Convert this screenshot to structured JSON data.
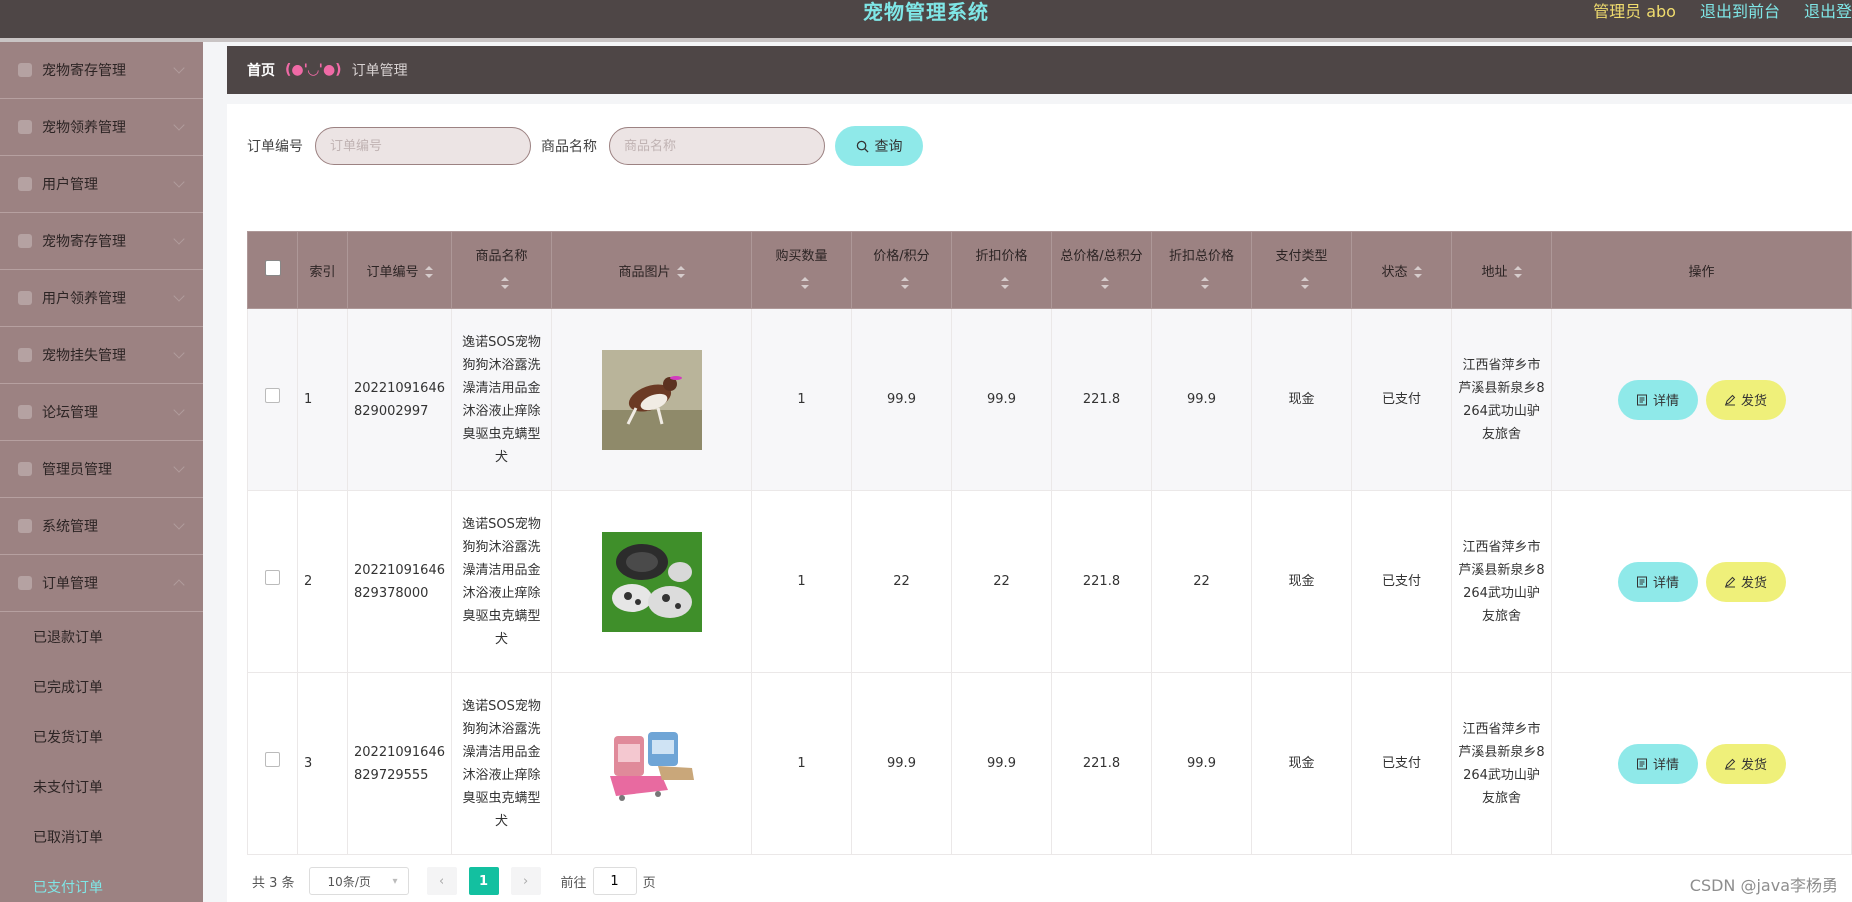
{
  "header": {
    "title": "宠物管理系统",
    "admin": "管理员 abo",
    "to_front": "退出到前台",
    "logout": "退出登"
  },
  "sidebar": {
    "items": [
      {
        "label": "宠物寄存管理",
        "icon": "shield-icon"
      },
      {
        "label": "宠物领养管理",
        "icon": "building-icon"
      },
      {
        "label": "用户管理",
        "icon": "folder-icon"
      },
      {
        "label": "宠物寄存管理",
        "icon": "chart-icon"
      },
      {
        "label": "用户领养管理",
        "icon": "grid-icon"
      },
      {
        "label": "宠物挂失管理",
        "icon": "lock-icon"
      },
      {
        "label": "论坛管理",
        "icon": "clipboard-icon"
      },
      {
        "label": "管理员管理",
        "icon": "send-icon"
      },
      {
        "label": "系统管理",
        "icon": "screen-icon"
      },
      {
        "label": "订单管理",
        "icon": "user-icon"
      }
    ],
    "sub_items": [
      "已退款订单",
      "已完成订单",
      "已发货订单",
      "未支付订单",
      "已取消订单",
      "已支付订单"
    ]
  },
  "breadcrumb": {
    "home": "首页",
    "sep": "(●'◡'●)",
    "current": "订单管理"
  },
  "search": {
    "order_label": "订单编号",
    "order_placeholder": "订单编号",
    "product_label": "商品名称",
    "product_placeholder": "商品名称",
    "query_label": "查询"
  },
  "table": {
    "headers": {
      "index": "索引",
      "order_no": "订单编号",
      "product_name": "商品名称",
      "product_image": "商品图片",
      "quantity": "购买数量",
      "price": "价格/积分",
      "discount_price": "折扣价格",
      "total": "总价格/总积分",
      "discount_total": "折扣总价格",
      "pay_type": "支付类型",
      "status": "状态",
      "address": "地址",
      "ops": "操作"
    },
    "rows": [
      {
        "index": "1",
        "order_no": "20221091646829002997",
        "product_name": "逸诺SOS宠物狗狗沐浴露洗澡清洁用品金沐浴液止痒除臭驱虫克螨型犬",
        "quantity": "1",
        "price": "99.9",
        "discount_price": "99.9",
        "total": "221.8",
        "discount_total": "99.9",
        "pay_type": "现金",
        "status": "已支付",
        "address": "江西省萍乡市芦溪县新泉乡8264武功山驴友旅舍",
        "image": "dog-photo"
      },
      {
        "index": "2",
        "order_no": "20221091646829378000",
        "product_name": "逸诺SOS宠物狗狗沐浴露洗澡清洁用品金沐浴液止痒除臭驱虫克螨型犬",
        "quantity": "1",
        "price": "22",
        "discount_price": "22",
        "total": "221.8",
        "discount_total": "22",
        "pay_type": "现金",
        "status": "已支付",
        "address": "江西省萍乡市芦溪县新泉乡8264武功山驴友旅舍",
        "image": "shoes-photo"
      },
      {
        "index": "3",
        "order_no": "20221091646829729555",
        "product_name": "逸诺SOS宠物狗狗沐浴露洗澡清洁用品金沐浴液止痒除臭驱虫克螨型犬",
        "quantity": "1",
        "price": "99.9",
        "discount_price": "99.9",
        "total": "221.8",
        "discount_total": "99.9",
        "pay_type": "现金",
        "status": "已支付",
        "address": "江西省萍乡市芦溪县新泉乡8264武功山驴友旅舍",
        "image": "pet-bed-photo"
      }
    ],
    "detail_label": "详情",
    "ship_label": "发货"
  },
  "pagination": {
    "total": "共 3 条",
    "page_size": "10条/页",
    "current_page": "1",
    "goto_label": "前往",
    "goto_value": "1",
    "page_suffix": "页"
  },
  "watermark": "CSDN @java李杨勇"
}
